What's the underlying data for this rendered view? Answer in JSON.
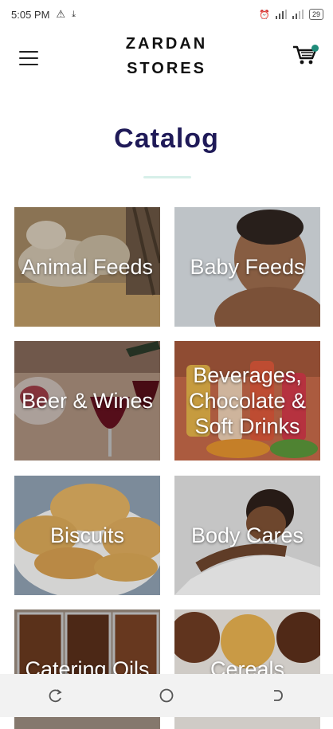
{
  "status": {
    "time": "5:05 PM",
    "battery": "29"
  },
  "header": {
    "brand_line1": "ZARDAN",
    "brand_line2": "STORES"
  },
  "page": {
    "title": "Catalog"
  },
  "categories": [
    {
      "label": "Animal Feeds"
    },
    {
      "label": "Baby Feeds"
    },
    {
      "label": "Beer & Wines"
    },
    {
      "label": "Beverages, Chocolate & Soft Drinks"
    },
    {
      "label": "Biscuits"
    },
    {
      "label": "Body Cares"
    },
    {
      "label": "Catering Oils"
    },
    {
      "label": "Cereals"
    }
  ],
  "icons": {
    "menu": "hamburger-icon",
    "cart": "shopping-cart-icon",
    "nav_recent": "recent-apps-icon",
    "nav_home": "home-circle-icon",
    "nav_back": "back-icon"
  },
  "colors": {
    "title": "#1f1a58",
    "accent": "#1f8c7a"
  }
}
